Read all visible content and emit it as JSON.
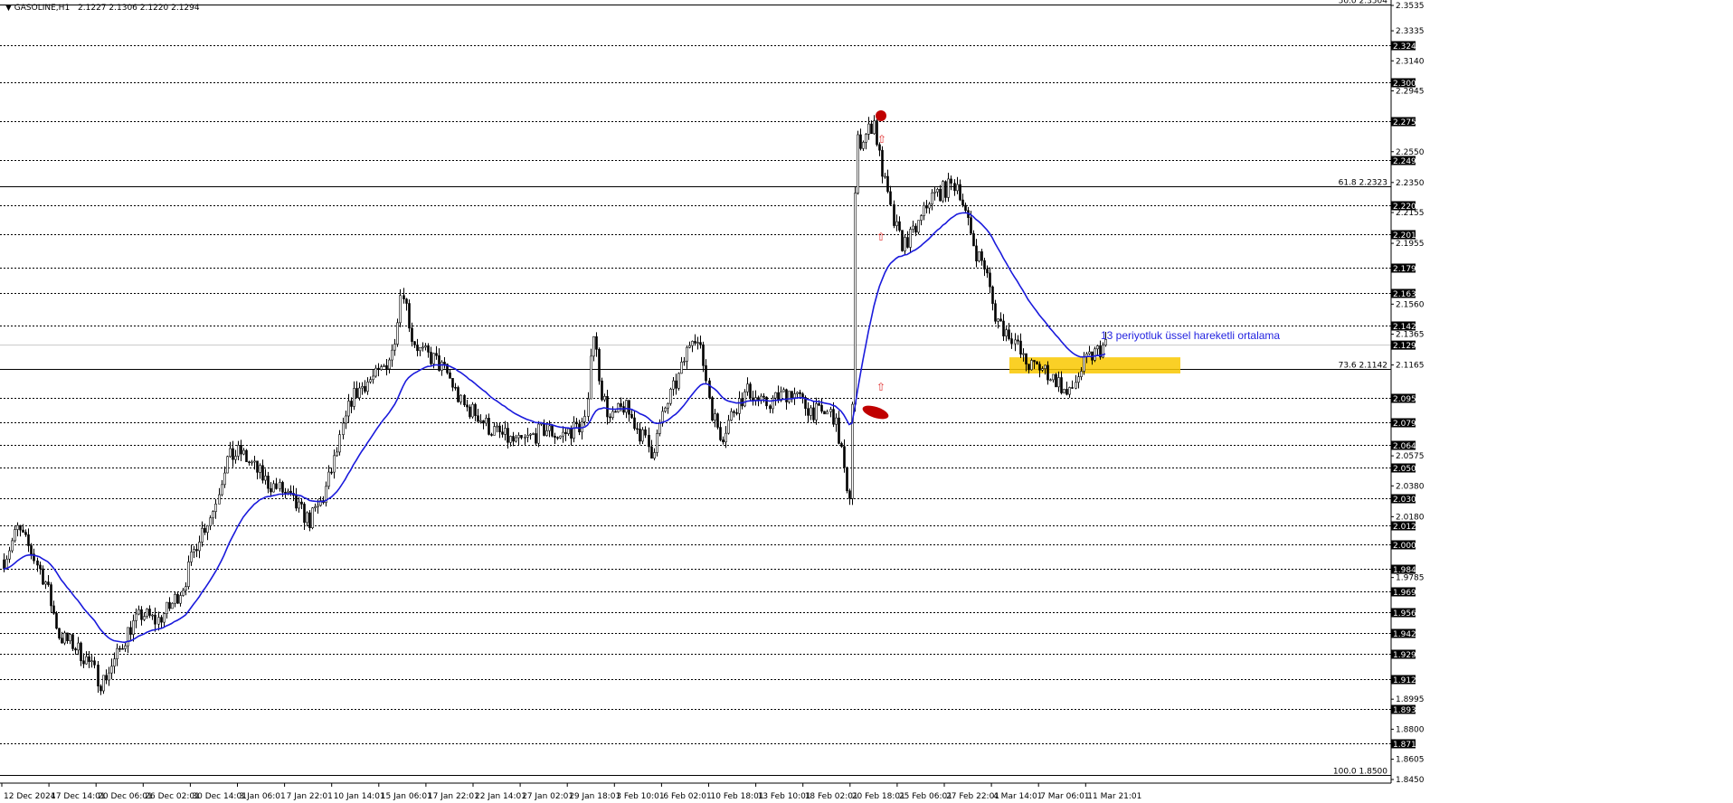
{
  "header": {
    "symbol": "GASOLINE,H1",
    "ohlc": "2.1227 2.1306 2.1220 2.1294"
  },
  "annotation": {
    "ema_label": "13 periyotluk üssel hareketli ortalama"
  },
  "colors": {
    "background": "#ffffff",
    "candle": "#000000",
    "ema": "#1a1adc",
    "level_line": "#000000",
    "highlight_zone": "#f9c800",
    "marker": "#c00000",
    "arrow": "#e03030"
  },
  "chart_data": {
    "type": "candlestick",
    "ylim": [
      1.845,
      2.3535
    ],
    "price_axis_labels": [
      "2.3535",
      "2.3335",
      "2.3140",
      "2.2945",
      "2.2550",
      "2.2350",
      "2.2155",
      "2.1955",
      "2.1560",
      "2.1365",
      "2.1165",
      "2.0575",
      "2.0380",
      "2.0180",
      "1.9785",
      "1.8995",
      "1.8800",
      "1.8605",
      "1.8450"
    ],
    "levels": [
      {
        "label": "2.3240",
        "value": 2.324
      },
      {
        "label": "2.3000",
        "value": 2.3
      },
      {
        "label": "2.2750",
        "value": 2.275
      },
      {
        "label": "2.2495",
        "value": 2.2495
      },
      {
        "label": "2.2200",
        "value": 2.22
      },
      {
        "label": "2.2015",
        "value": 2.2015
      },
      {
        "label": "2.1795",
        "value": 2.1795
      },
      {
        "label": "2.1630",
        "value": 2.163
      },
      {
        "label": "2.1420",
        "value": 2.142
      },
      {
        "label": "2.0950",
        "value": 2.095
      },
      {
        "label": "2.0795",
        "value": 2.0795
      },
      {
        "label": "2.0645",
        "value": 2.0645
      },
      {
        "label": "2.0500",
        "value": 2.05
      },
      {
        "label": "2.0300",
        "value": 2.03
      },
      {
        "label": "2.0125",
        "value": 2.0125
      },
      {
        "label": "2.0000",
        "value": 2.0
      },
      {
        "label": "1.9840",
        "value": 1.984
      },
      {
        "label": "1.9695",
        "value": 1.9695
      },
      {
        "label": "1.9560",
        "value": 1.956
      },
      {
        "label": "1.9425",
        "value": 1.9425
      },
      {
        "label": "1.9290",
        "value": 1.929
      },
      {
        "label": "1.9125",
        "value": 1.9125
      },
      {
        "label": "1.8930",
        "value": 1.893
      },
      {
        "label": "1.8710",
        "value": 1.871
      }
    ],
    "current_price": {
      "label": "2.1294",
      "value": 2.1294
    },
    "fibonacci": [
      {
        "label": "50.0 2.3504",
        "value": 2.3504
      },
      {
        "label": "61.8 2.2323",
        "value": 2.2323
      },
      {
        "label": "73.6 2.1142",
        "value": 2.1142
      },
      {
        "label": "100.0 1.8500",
        "value": 1.85
      }
    ],
    "x_labels": [
      "12 Dec 2024",
      "17 Dec 14:01",
      "20 Dec 06:01",
      "26 Dec 02:01",
      "30 Dec 14:01",
      "3 Jan 06:01",
      "7 Jan 22:01",
      "10 Jan 14:01",
      "15 Jan 06:01",
      "17 Jan 22:01",
      "22 Jan 14:01",
      "27 Jan 02:01",
      "29 Jan 18:01",
      "3 Feb 10:01",
      "6 Feb 02:01",
      "10 Feb 18:01",
      "13 Feb 10:01",
      "18 Feb 02:01",
      "20 Feb 18:01",
      "25 Feb 06:01",
      "27 Feb 22:01",
      "4 Mar 14:01",
      "7 Mar 06:01",
      "11 Mar 21:01"
    ],
    "price_path": [
      [
        0,
        1.99
      ],
      [
        3,
        2.01
      ],
      [
        6,
        1.995
      ],
      [
        9,
        1.975
      ],
      [
        12,
        1.94
      ],
      [
        15,
        1.935
      ],
      [
        18,
        1.925
      ],
      [
        21,
        1.91
      ],
      [
        24,
        1.925
      ],
      [
        27,
        1.945
      ],
      [
        30,
        1.955
      ],
      [
        33,
        1.95
      ],
      [
        36,
        1.96
      ],
      [
        39,
        1.975
      ],
      [
        42,
        2.005
      ],
      [
        45,
        2.02
      ],
      [
        48,
        2.055
      ],
      [
        51,
        2.06
      ],
      [
        54,
        2.05
      ],
      [
        57,
        2.04
      ],
      [
        60,
        2.035
      ],
      [
        63,
        2.025
      ],
      [
        66,
        2.015
      ],
      [
        69,
        2.03
      ],
      [
        72,
        2.06
      ],
      [
        75,
        2.095
      ],
      [
        78,
        2.105
      ],
      [
        81,
        2.11
      ],
      [
        84,
        2.125
      ],
      [
        86,
        2.17
      ],
      [
        88,
        2.135
      ],
      [
        90,
        2.125
      ],
      [
        93,
        2.12
      ],
      [
        96,
        2.11
      ],
      [
        99,
        2.09
      ],
      [
        102,
        2.085
      ],
      [
        105,
        2.075
      ],
      [
        108,
        2.07
      ],
      [
        111,
        2.065
      ],
      [
        114,
        2.07
      ],
      [
        117,
        2.075
      ],
      [
        120,
        2.07
      ],
      [
        123,
        2.075
      ],
      [
        126,
        2.08
      ],
      [
        127,
        2.145
      ],
      [
        129,
        2.1
      ],
      [
        131,
        2.08
      ],
      [
        134,
        2.09
      ],
      [
        137,
        2.075
      ],
      [
        140,
        2.06
      ],
      [
        143,
        2.09
      ],
      [
        146,
        2.11
      ],
      [
        149,
        2.14
      ],
      [
        151,
        2.12
      ],
      [
        153,
        2.085
      ],
      [
        155,
        2.07
      ],
      [
        158,
        2.09
      ],
      [
        161,
        2.1
      ],
      [
        164,
        2.09
      ],
      [
        167,
        2.095
      ],
      [
        170,
        2.1
      ],
      [
        173,
        2.09
      ],
      [
        176,
        2.085
      ],
      [
        179,
        2.085
      ],
      [
        181,
        2.06
      ],
      [
        182,
        2.03
      ],
      [
        183,
        2.035
      ],
      [
        184,
        2.26
      ],
      [
        186,
        2.265
      ],
      [
        188,
        2.275
      ],
      [
        189,
        2.255
      ],
      [
        190,
        2.24
      ],
      [
        192,
        2.21
      ],
      [
        194,
        2.195
      ],
      [
        196,
        2.2
      ],
      [
        198,
        2.21
      ],
      [
        200,
        2.225
      ],
      [
        203,
        2.23
      ],
      [
        206,
        2.235
      ],
      [
        208,
        2.21
      ],
      [
        210,
        2.19
      ],
      [
        212,
        2.18
      ],
      [
        214,
        2.15
      ],
      [
        216,
        2.14
      ],
      [
        218,
        2.135
      ],
      [
        220,
        2.12
      ],
      [
        222,
        2.115
      ],
      [
        224,
        2.115
      ],
      [
        226,
        2.11
      ],
      [
        228,
        2.105
      ],
      [
        230,
        2.095
      ],
      [
        232,
        2.11
      ],
      [
        234,
        2.12
      ],
      [
        236,
        2.125
      ],
      [
        238,
        2.1294
      ]
    ],
    "highlight_zone": {
      "from": 2.111,
      "to": 2.1215
    }
  }
}
